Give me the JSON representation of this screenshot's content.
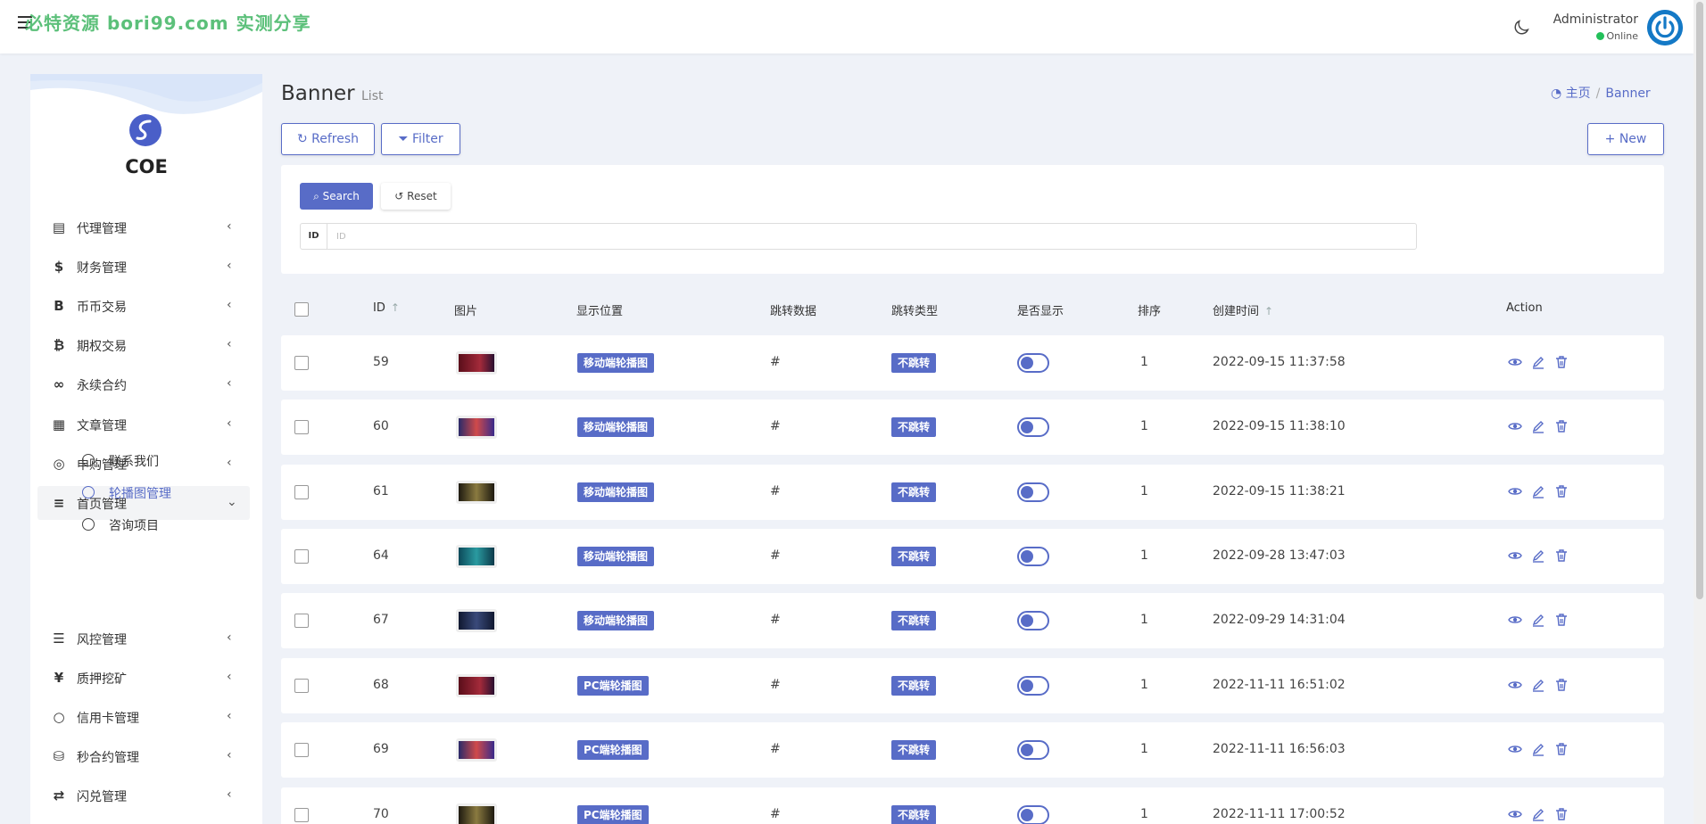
{
  "watermark": "必特资源 bori99.com 实测分享",
  "user": {
    "name": "Administrator",
    "status": "Online"
  },
  "brand": "COE",
  "sidebar": {
    "items": [
      {
        "label": "代理管理",
        "icon": "id-card-icon",
        "glyph": "▤"
      },
      {
        "label": "财务管理",
        "icon": "dollar-icon",
        "glyph": "$"
      },
      {
        "label": "币币交易",
        "icon": "b-letter-icon",
        "glyph": "B"
      },
      {
        "label": "期权交易",
        "icon": "bitcoin-icon",
        "glyph": "₿"
      },
      {
        "label": "永续合约",
        "icon": "link-icon",
        "glyph": "∞"
      },
      {
        "label": "文章管理",
        "icon": "newspaper-icon",
        "glyph": "▦"
      },
      {
        "label": "申购管理",
        "icon": "lifebuoy-icon",
        "glyph": "◎"
      },
      {
        "label": "首页管理",
        "icon": "list-icon",
        "glyph": "≡"
      },
      {
        "label": "风控管理",
        "icon": "list-indent-icon",
        "glyph": "☰"
      },
      {
        "label": "质押挖矿",
        "icon": "yen-icon",
        "glyph": "¥"
      },
      {
        "label": "信用卡管理",
        "icon": "circle-icon",
        "glyph": "○"
      },
      {
        "label": "秒合约管理",
        "icon": "coins-icon",
        "glyph": "⛁"
      },
      {
        "label": "闪兑管理",
        "icon": "exchange-icon",
        "glyph": "⇄"
      }
    ],
    "sub_items": [
      {
        "label": "联系我们"
      },
      {
        "label": "轮播图管理"
      },
      {
        "label": "咨询项目"
      }
    ]
  },
  "page": {
    "title": "Banner",
    "subtitle": "List"
  },
  "breadcrumb": {
    "home": "主页",
    "current": "Banner"
  },
  "toolbar": {
    "refresh": "Refresh",
    "filter": "Filter",
    "new": "New"
  },
  "search": {
    "search_label": "Search",
    "reset_label": "Reset",
    "id_addon": "ID",
    "id_placeholder": "ID"
  },
  "table": {
    "headers": {
      "id": "ID",
      "image": "图片",
      "position": "显示位置",
      "jump_data": "跳转数据",
      "jump_type": "跳转类型",
      "is_show": "是否显示",
      "sort": "排序",
      "created": "创建时间",
      "action": "Action"
    },
    "rows": [
      {
        "id": "59",
        "position": "移动端轮播图",
        "jump_data": "#",
        "jump_type": "不跳转",
        "sort": "1",
        "created": "2022-09-15 11:37:58"
      },
      {
        "id": "60",
        "position": "移动端轮播图",
        "jump_data": "#",
        "jump_type": "不跳转",
        "sort": "1",
        "created": "2022-09-15 11:38:10"
      },
      {
        "id": "61",
        "position": "移动端轮播图",
        "jump_data": "#",
        "jump_type": "不跳转",
        "sort": "1",
        "created": "2022-09-15 11:38:21"
      },
      {
        "id": "64",
        "position": "移动端轮播图",
        "jump_data": "#",
        "jump_type": "不跳转",
        "sort": "1",
        "created": "2022-09-28 13:47:03"
      },
      {
        "id": "67",
        "position": "移动端轮播图",
        "jump_data": "#",
        "jump_type": "不跳转",
        "sort": "1",
        "created": "2022-09-29 14:31:04"
      },
      {
        "id": "68",
        "position": "PC端轮播图",
        "jump_data": "#",
        "jump_type": "不跳转",
        "sort": "1",
        "created": "2022-11-11 16:51:02"
      },
      {
        "id": "69",
        "position": "PC端轮播图",
        "jump_data": "#",
        "jump_type": "不跳转",
        "sort": "1",
        "created": "2022-11-11 16:56:03"
      },
      {
        "id": "70",
        "position": "PC端轮播图",
        "jump_data": "#",
        "jump_type": "不跳转",
        "sort": "1",
        "created": "2022-11-11 17:00:52"
      }
    ]
  },
  "colors": {
    "primary": "#586cc7",
    "background": "#eff2f8",
    "online": "#23c05a",
    "watermark": "#5cc07a"
  }
}
